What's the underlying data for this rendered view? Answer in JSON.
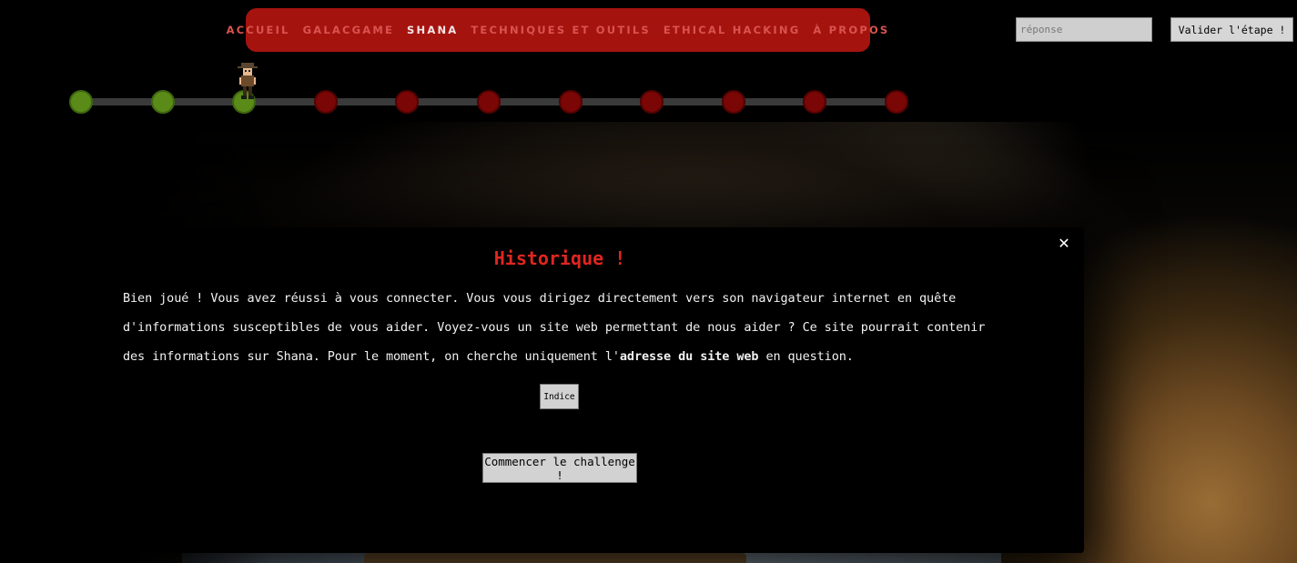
{
  "nav": {
    "items": [
      {
        "label": "ACCUEIL",
        "active": false
      },
      {
        "label": "GALACGAME",
        "active": false
      },
      {
        "label": "SHANA",
        "active": true
      },
      {
        "label": "TECHNIQUES ET OUTILS",
        "active": false
      },
      {
        "label": "ETHICAL HACKING",
        "active": false
      },
      {
        "label": "À PROPOS",
        "active": false
      }
    ]
  },
  "answer": {
    "placeholder": "réponse",
    "value": "",
    "submit_label": "Valider l'étape !"
  },
  "progress": {
    "total_steps": 11,
    "completed_steps": 3,
    "current_step": 3
  },
  "colors": {
    "nav_bg": "#a5130f",
    "nav_text": "#d9534f",
    "nav_active": "#f2e4e4",
    "step_done": "#5a8a18",
    "step_todo": "#7a0606",
    "title": "#e0261f"
  },
  "modal": {
    "close_icon": "✕",
    "title": "Historique !",
    "text_before": "Bien joué ! Vous avez réussi à vous connecter. Vous vous dirigez directement vers son navigateur internet en quête d'informations susceptibles de vous aider. Voyez-vous un site web permettant de nous aider ? Ce site pourrait contenir des informations sur Shana. Pour le moment, on cherche uniquement l'",
    "text_bold": "adresse du site web",
    "text_after": " en question.",
    "hint_label": "Indice",
    "start_label": "Commencer le challenge !"
  }
}
